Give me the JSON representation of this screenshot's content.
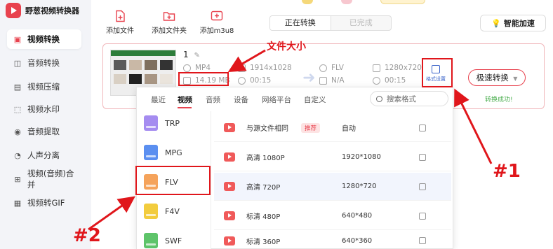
{
  "app": {
    "title": "野葱视频转换器"
  },
  "sidebar": {
    "items": [
      {
        "label": "视频转换",
        "icon": "video-convert-icon",
        "active": true
      },
      {
        "label": "音频转换",
        "icon": "audio-convert-icon"
      },
      {
        "label": "视频压缩",
        "icon": "video-compress-icon"
      },
      {
        "label": "视频水印",
        "icon": "watermark-icon"
      },
      {
        "label": "音频提取",
        "icon": "audio-extract-icon"
      },
      {
        "label": "人声分离",
        "icon": "voice-separate-icon"
      },
      {
        "label": "视频(音频)合并",
        "icon": "merge-icon"
      },
      {
        "label": "视频转GIF",
        "icon": "gif-icon"
      }
    ]
  },
  "toolbar": {
    "add_file": "添加文件",
    "add_folder": "添加文件夹",
    "add_m3u8": "添加m3u8",
    "accel_label": "智能加速"
  },
  "status_tabs": [
    {
      "label": "正在转换",
      "active": true
    },
    {
      "label": "已完成",
      "active": false
    }
  ],
  "task": {
    "name": "1",
    "source": {
      "format": "MP4",
      "resolution": "1914x1028",
      "size": "14.19 MB",
      "duration": "00:15"
    },
    "target": {
      "format": "FLV",
      "resolution": "1280x720",
      "size": "N/A",
      "duration": "00:15"
    },
    "format_settings_label": "格式设置",
    "convert_button": "极速转换",
    "status": "转换成功!"
  },
  "format_popup": {
    "tabs": [
      {
        "label": "最近"
      },
      {
        "label": "视频",
        "active": true
      },
      {
        "label": "音频"
      },
      {
        "label": "设备"
      },
      {
        "label": "网络平台"
      },
      {
        "label": "自定义"
      }
    ],
    "search_placeholder": "搜索格式",
    "formats": [
      {
        "label": "TRP",
        "color": "#a58cf0"
      },
      {
        "label": "MPG",
        "color": "#5b8ff0"
      },
      {
        "label": "FLV",
        "color": "#f5a35b",
        "selected": true
      },
      {
        "label": "F4V",
        "color": "#f2cc3e"
      },
      {
        "label": "SWF",
        "color": "#5ec46a"
      }
    ],
    "presets": [
      {
        "name": "与源文件相同",
        "tag": "推荐",
        "resolution": "自动"
      },
      {
        "name": "高清 1080P",
        "resolution": "1920*1080"
      },
      {
        "name": "高清 720P",
        "resolution": "1280*720",
        "selected": true
      },
      {
        "name": "标清 480P",
        "resolution": "640*480"
      },
      {
        "name": "标清 360P",
        "resolution": "640*360"
      }
    ]
  },
  "annotations": {
    "file_size_label": "文件大小",
    "marker_1": "#1",
    "marker_2": "#2",
    "color": "#e0161b"
  }
}
